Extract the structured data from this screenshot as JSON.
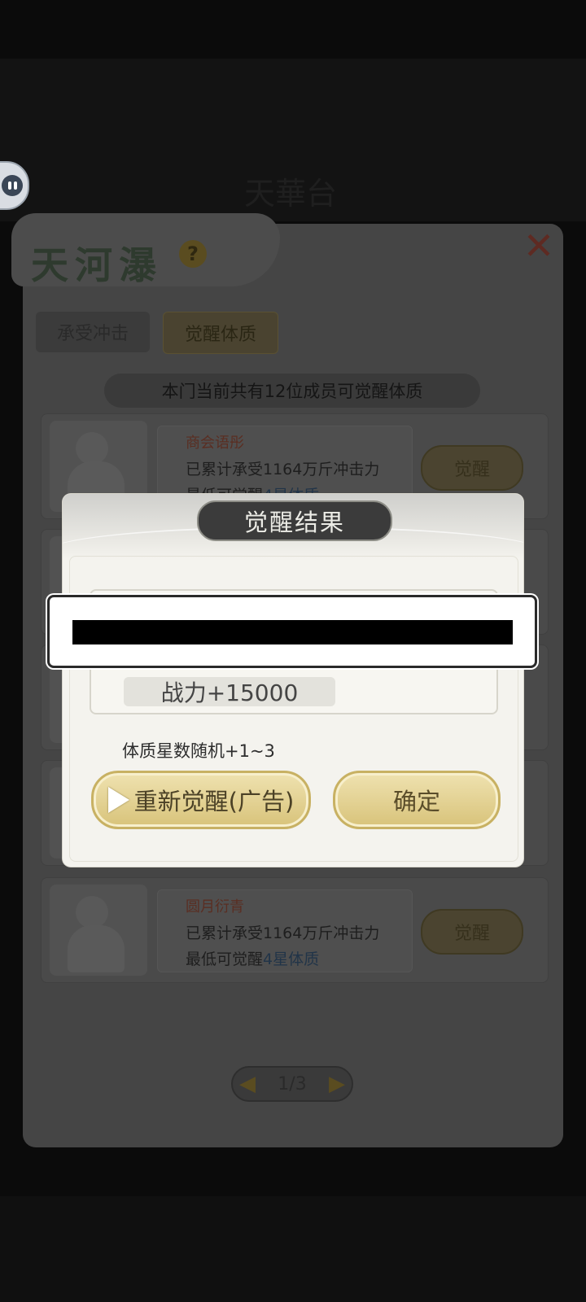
{
  "background": {
    "header_title": "天華台",
    "panel_title": "天河瀑",
    "tabs": [
      {
        "label": "承受冲击"
      },
      {
        "label": "觉醒体质"
      }
    ],
    "member_count_text": "本门当前共有12位成员可觉醒体质",
    "members": [
      {
        "name": "商会语彤",
        "line1": "已累计承受1164万斤冲击力",
        "line2_prefix": "最低可觉醒",
        "line2_star": "4星体质",
        "button": "觉醒"
      },
      {
        "name": "圆月衍青",
        "line1": "已累计承受1164万斤冲击力",
        "line2_prefix": "最低可觉醒",
        "line2_star": "4星体质",
        "button": "觉醒"
      }
    ],
    "pager": {
      "page": "1/3",
      "prev_icon": "triangle-left-icon",
      "next_icon": "triangle-right-icon"
    },
    "help_icon": "question-icon",
    "close_icon": "close-icon"
  },
  "dialog": {
    "title": "觉醒结果",
    "power_text": "战力+15000",
    "star_note": "体质星数随机+1~3",
    "rewatch_button": "重新觉醒(广告)",
    "confirm_button": "确定",
    "play_icon": "play-icon"
  },
  "colors": {
    "dialog_bg": "#f4f3ee",
    "gold_button": "#d8c37a",
    "title_plate": "#3b3b3b"
  }
}
